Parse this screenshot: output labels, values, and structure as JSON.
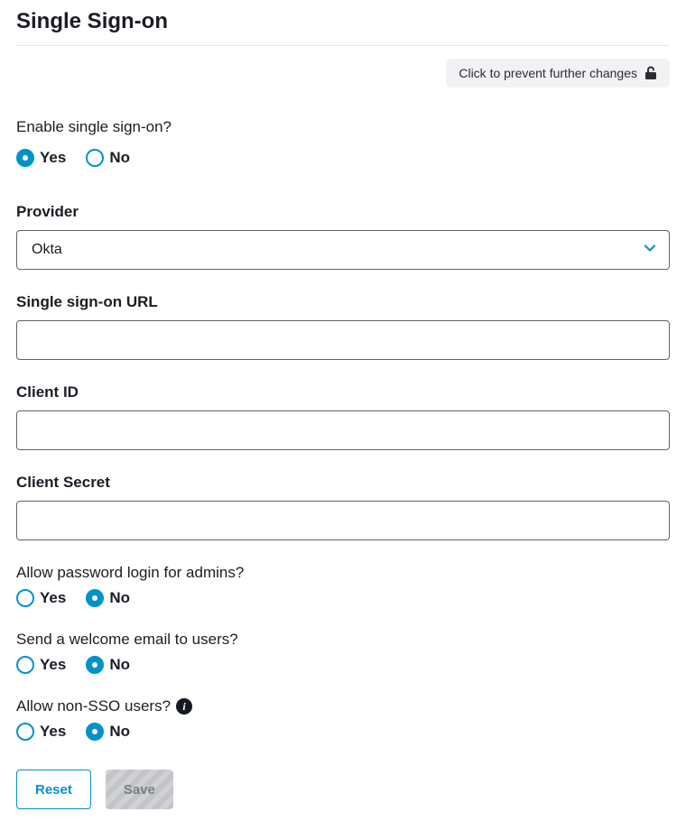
{
  "page": {
    "title": "Single Sign-on"
  },
  "lock": {
    "label": "Click to prevent further changes"
  },
  "enable": {
    "label": "Enable single sign-on?",
    "yes": "Yes",
    "no": "No",
    "selected": "yes"
  },
  "provider": {
    "label": "Provider",
    "value": "Okta"
  },
  "sso_url": {
    "label": "Single sign-on URL",
    "value": ""
  },
  "client_id": {
    "label": "Client ID",
    "value": ""
  },
  "client_secret": {
    "label": "Client Secret",
    "value": ""
  },
  "allow_admin_pw": {
    "label": "Allow password login for admins?",
    "yes": "Yes",
    "no": "No",
    "selected": "no"
  },
  "welcome_email": {
    "label": "Send a welcome email to users?",
    "yes": "Yes",
    "no": "No",
    "selected": "no"
  },
  "allow_non_sso": {
    "label": "Allow non-SSO users?",
    "yes": "Yes",
    "no": "No",
    "selected": "no"
  },
  "buttons": {
    "reset": "Reset",
    "save": "Save"
  }
}
